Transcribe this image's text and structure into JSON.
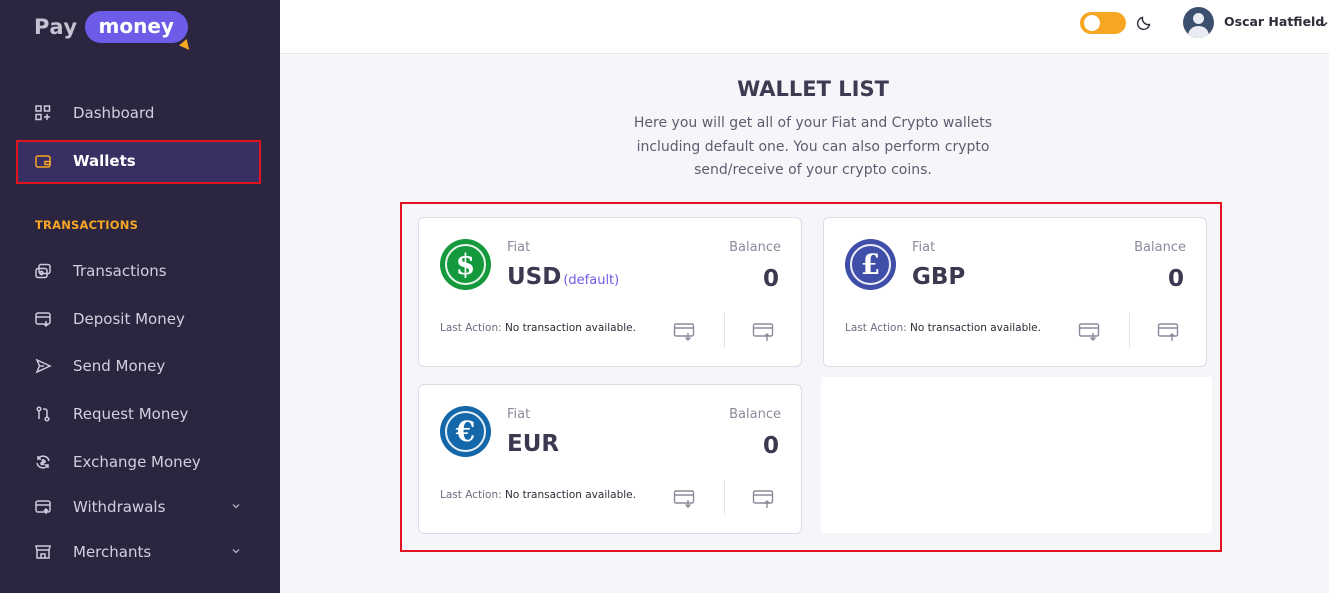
{
  "app": {
    "logo_pay": "Pay",
    "logo_money": "money"
  },
  "sidebar": {
    "items": [
      {
        "label": "Dashboard",
        "icon": "dashboard-icon"
      },
      {
        "label": "Wallets",
        "icon": "wallet-icon",
        "active": true
      }
    ],
    "section_heading": "TRANSACTIONS",
    "transaction_items": [
      {
        "label": "Transactions",
        "icon": "transactions-icon"
      },
      {
        "label": "Deposit Money",
        "icon": "deposit-icon"
      },
      {
        "label": "Send Money",
        "icon": "send-icon"
      },
      {
        "label": "Request Money",
        "icon": "request-icon"
      },
      {
        "label": "Exchange Money",
        "icon": "exchange-icon"
      },
      {
        "label": "Withdrawals",
        "icon": "withdrawals-icon",
        "has_submenu": true
      },
      {
        "label": "Merchants",
        "icon": "merchants-icon",
        "has_submenu": true
      }
    ]
  },
  "header": {
    "theme_toggle": "light",
    "user_name": "Oscar Hatfield"
  },
  "main": {
    "title": "WALLET LIST",
    "description": "Here you will get all of your Fiat and Crypto wallets including default one. You can also perform crypto send/receive of your crypto coins."
  },
  "wallets": [
    {
      "type": "Fiat",
      "currency": "USD",
      "default_tag": "(default)",
      "symbol": "$",
      "color": "#149a3c",
      "balance_label": "Balance",
      "balance": "0",
      "last_action_label": "Last Action:",
      "last_action": "No transaction available."
    },
    {
      "type": "Fiat",
      "currency": "GBP",
      "default_tag": "",
      "symbol": "£",
      "color": "#3f4ea8",
      "balance_label": "Balance",
      "balance": "0",
      "last_action_label": "Last Action:",
      "last_action": "No transaction available."
    },
    {
      "type": "Fiat",
      "currency": "EUR",
      "default_tag": "",
      "symbol": "€",
      "color": "#1467a8",
      "balance_label": "Balance",
      "balance": "0",
      "last_action_label": "Last Action:",
      "last_action": "No transaction available."
    }
  ],
  "colors": {
    "sidebar_bg": "#2b2540",
    "accent": "#6c5ce7",
    "section_heading": "#f6a623",
    "highlight": "#e0141e"
  }
}
